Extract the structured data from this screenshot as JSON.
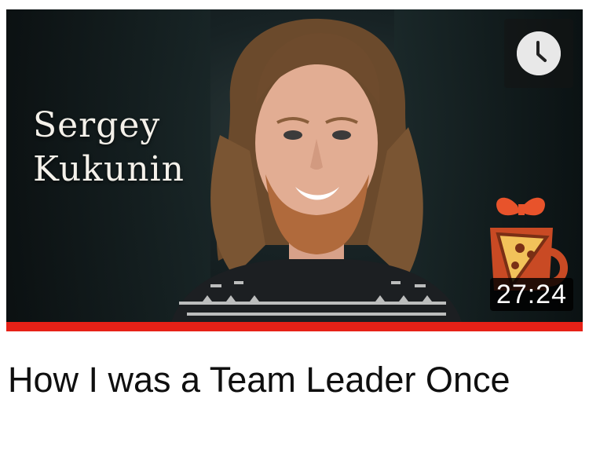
{
  "thumbnail": {
    "overlay_name_line1": "Sergey",
    "overlay_name_line2": "Kukunin",
    "duration": "27:24",
    "watch_later_icon": "clock-icon",
    "logo_icon": "pizza-mug-logo-icon"
  },
  "progress": {
    "watched_fraction": 1.0,
    "color": "#e62117"
  },
  "video": {
    "title": "How I was a Team Leader Once"
  },
  "colors": {
    "title_text": "#0f0f0f",
    "duration_bg": "#000000",
    "logo_accent": "#e8532b"
  }
}
